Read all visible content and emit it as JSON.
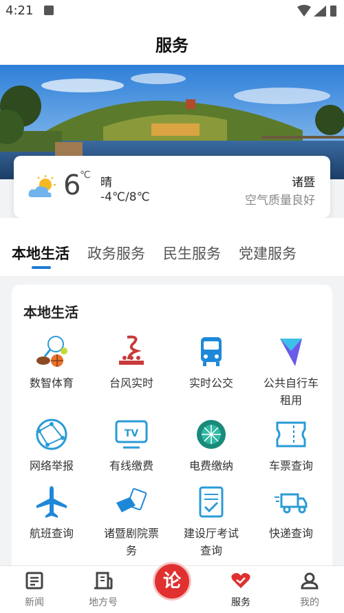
{
  "status_bar": {
    "time": "4:21"
  },
  "header": {
    "title": "服务"
  },
  "weather": {
    "temperature": "6",
    "degree_unit": "℃",
    "condition": "晴",
    "range": "-4℃/8℃",
    "city": "诸暨",
    "air_quality": "空气质量良好"
  },
  "tabs": [
    "本地生活",
    "政务服务",
    "民生服务",
    "党建服务"
  ],
  "section": {
    "title": "本地生活",
    "items": [
      {
        "label": "数智体育",
        "icon": "sports-icon"
      },
      {
        "label": "台风实时",
        "icon": "typhoon-icon"
      },
      {
        "label": "实时公交",
        "icon": "bus-icon"
      },
      {
        "label": "公共自行车租用",
        "icon": "bike-arrow-icon"
      },
      {
        "label": "网络举报",
        "icon": "network-icon"
      },
      {
        "label": "有线缴费",
        "icon": "tv-icon"
      },
      {
        "label": "电费缴纳",
        "icon": "power-grid-icon"
      },
      {
        "label": "车票查询",
        "icon": "ticket-icon"
      },
      {
        "label": "航班查询",
        "icon": "airplane-icon"
      },
      {
        "label": "诸暨剧院票务",
        "icon": "theater-ticket-icon"
      },
      {
        "label": "建设厅考试查询",
        "icon": "clipboard-check-icon"
      },
      {
        "label": "快递查询",
        "icon": "delivery-truck-icon"
      }
    ]
  },
  "bottom_nav": {
    "items": [
      {
        "label": "新闻",
        "icon": "news-icon"
      },
      {
        "label": "地方号",
        "icon": "building-icon"
      },
      {
        "label": "服务",
        "icon": "service-heart-icon"
      },
      {
        "label": "我的",
        "icon": "profile-icon"
      }
    ],
    "center_label": "论"
  },
  "colors": {
    "accent": "#1e7bd6",
    "center_button": "#e03030",
    "service_active": "#e03030"
  }
}
